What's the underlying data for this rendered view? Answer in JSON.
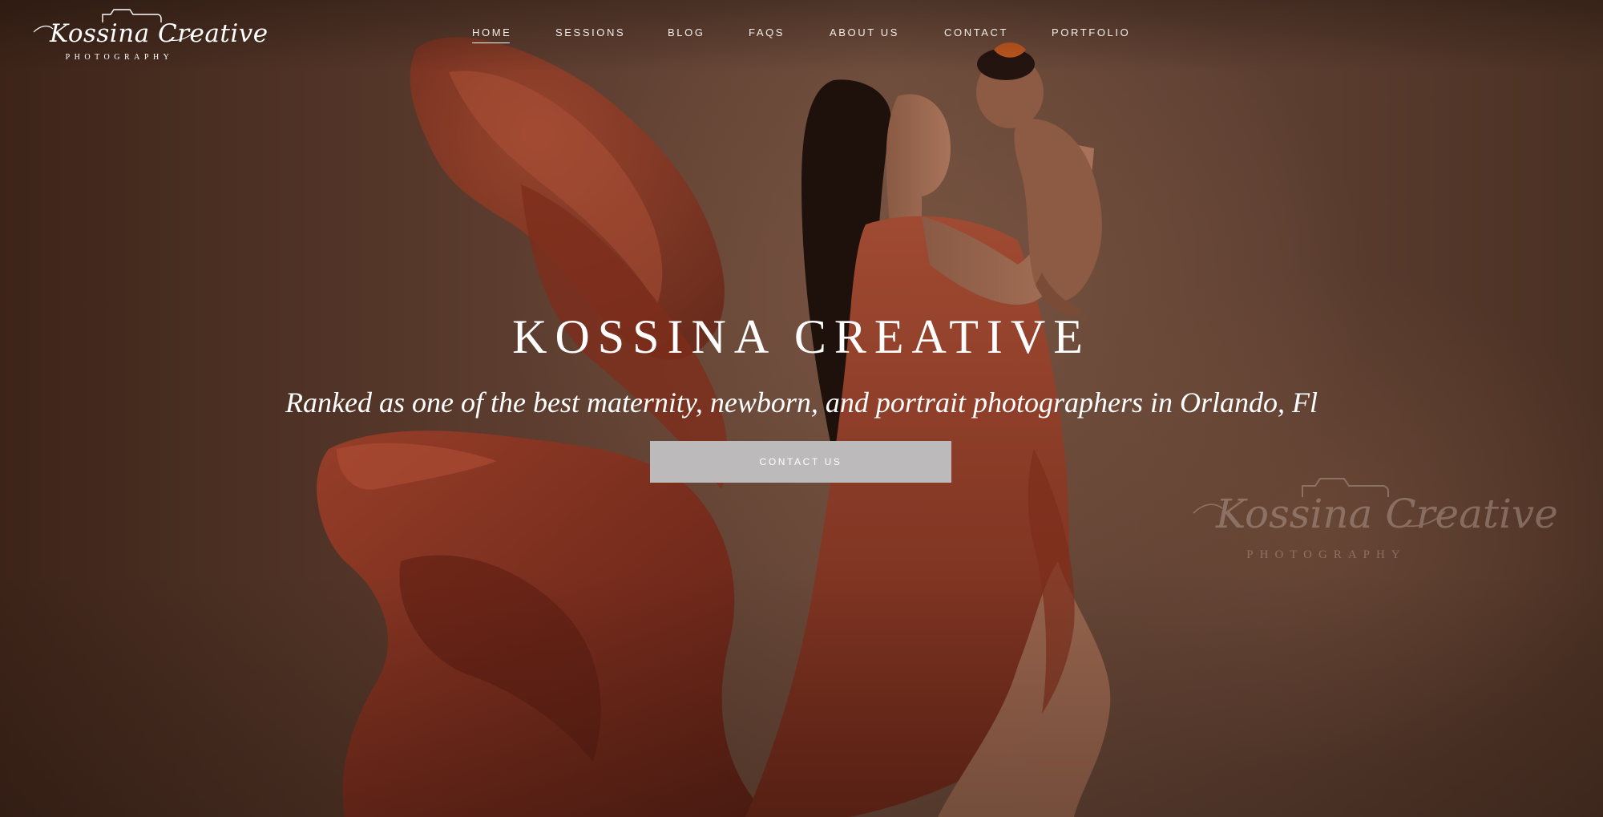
{
  "brand": {
    "logo_script": "Kossina Creative",
    "logo_sub": "PHOTOGRAPHY"
  },
  "nav": {
    "items": [
      {
        "label": "HOME",
        "active": true
      },
      {
        "label": "SESSIONS",
        "active": false
      },
      {
        "label": "BLOG",
        "active": false
      },
      {
        "label": "FAQS",
        "active": false
      },
      {
        "label": "ABOUT US",
        "active": false
      },
      {
        "label": "CONTACT",
        "active": false
      },
      {
        "label": "PORTFOLIO",
        "active": false
      }
    ]
  },
  "hero": {
    "title": "KOSSINA CREATIVE",
    "subtitle": "Ranked as one of the best maternity, newborn, and portrait photographers in Orlando, Fl",
    "cta_label": "CONTACT US",
    "image_description_icon": "hero-photo"
  },
  "watermark": {
    "script": "Kossina Creative",
    "sub": "PHOTOGRAPHY"
  },
  "colors": {
    "background": "#5a3b2d",
    "fabric": "#8e3a26",
    "text": "#ffffff",
    "cta_background": "#bcbabb"
  }
}
